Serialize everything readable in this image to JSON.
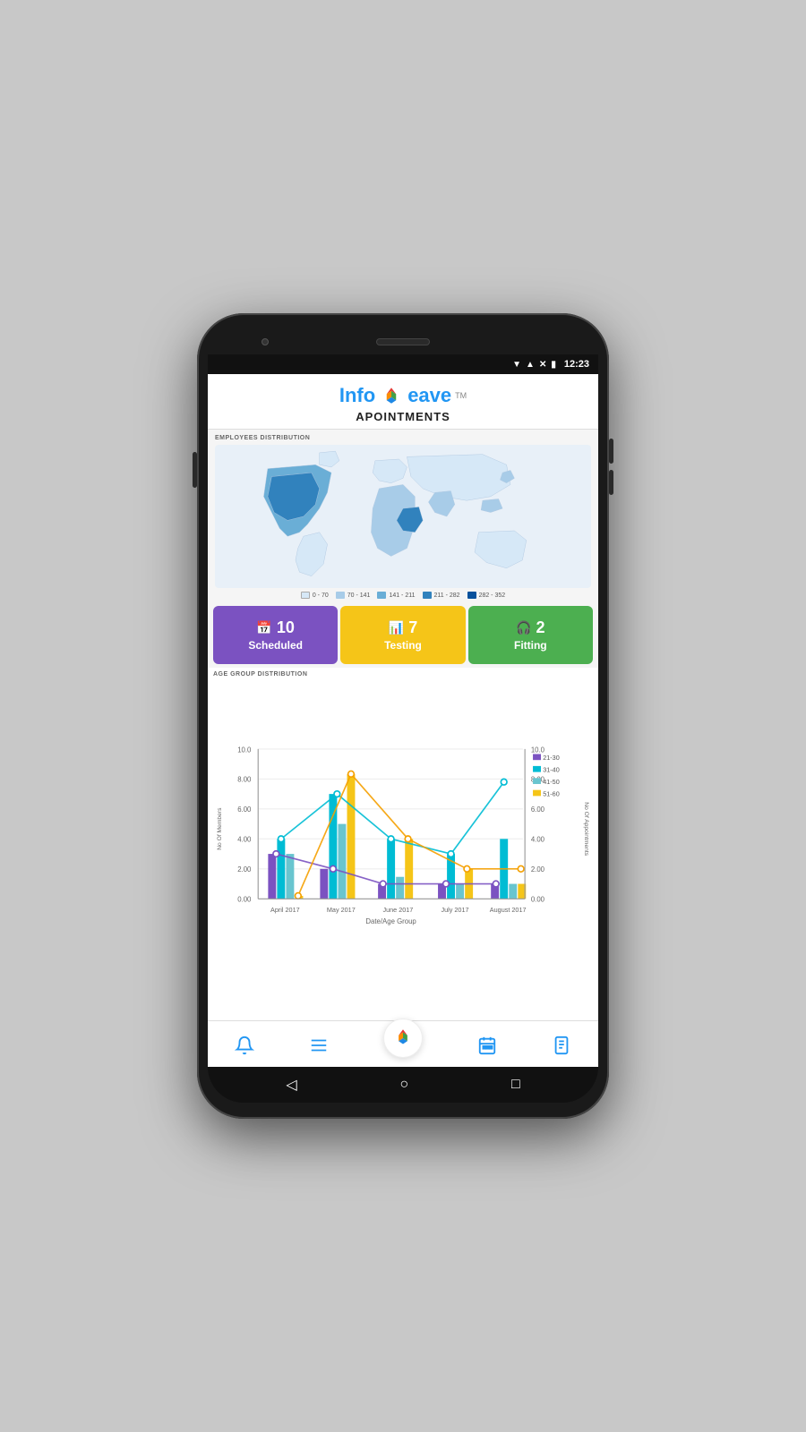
{
  "app": {
    "logo_info": "Info",
    "logo_eave": "eave",
    "logo_tm": "TM",
    "page_title": "APOINTMENTS"
  },
  "status_bar": {
    "time": "12:23"
  },
  "map_section": {
    "label": "EMPLOYEES DISTRIBUTION",
    "legend": [
      {
        "range": "0 - 70",
        "color": "#d6e8f7"
      },
      {
        "range": "70 - 141",
        "color": "#a8cce8"
      },
      {
        "range": "141 - 211",
        "color": "#6aaed6"
      },
      {
        "range": "211 - 282",
        "color": "#3182bd"
      },
      {
        "range": "282 - 352",
        "color": "#08519c"
      }
    ]
  },
  "stats": [
    {
      "id": "scheduled",
      "icon": "📅",
      "number": "10",
      "label": "Scheduled",
      "color": "#7B52C1"
    },
    {
      "id": "testing",
      "icon": "📊",
      "number": "7",
      "label": "Testing",
      "color": "#F5C518"
    },
    {
      "id": "fitting",
      "icon": "🎧",
      "number": "2",
      "label": "Fitting",
      "color": "#4CAF50"
    }
  ],
  "chart": {
    "label": "AGE GROUP DISTRIBUTION",
    "x_label": "Date/Age Group",
    "y_left_label": "No Of Members",
    "y_right_label": "No Of Appointments",
    "legend": [
      {
        "label": "21-30",
        "color": "#7B52C1"
      },
      {
        "label": "31-40",
        "color": "#00BCD4"
      },
      {
        "label": "41-50",
        "color": "#69C5CF"
      },
      {
        "label": "51-60",
        "color": "#F5C518"
      }
    ],
    "months": [
      "April 2017",
      "May 2017",
      "June 2017",
      "July 2017",
      "August 2017"
    ]
  },
  "nav": {
    "items": [
      {
        "id": "bell",
        "icon": "🔔",
        "label": "notifications"
      },
      {
        "id": "list",
        "icon": "☰",
        "label": "menu"
      },
      {
        "id": "home",
        "icon": "home",
        "label": "home"
      },
      {
        "id": "calendar",
        "icon": "📅",
        "label": "calendar"
      },
      {
        "id": "doc",
        "icon": "📋",
        "label": "documents"
      }
    ]
  }
}
